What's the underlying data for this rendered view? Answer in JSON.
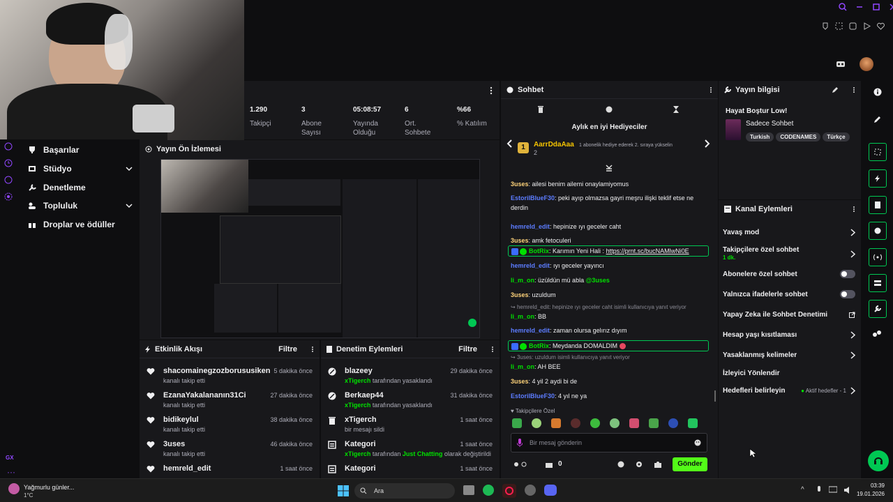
{
  "stats": [
    {
      "value": "1.290",
      "label": "Takipçi"
    },
    {
      "value": "3",
      "label": "Abone Sayısı"
    },
    {
      "value": "05:08:57",
      "label": "Yayında Olduğu"
    },
    {
      "value": "6",
      "label": "Ort. Sohbete"
    },
    {
      "value": "%66",
      "label": "% Katılım"
    }
  ],
  "nav": {
    "items": [
      {
        "label": "Başarılar"
      },
      {
        "label": "Stüdyo"
      },
      {
        "label": "Denetleme"
      },
      {
        "label": "Topluluk"
      },
      {
        "label": "Droplar ve ödüller"
      }
    ],
    "gx": "GX"
  },
  "preview": {
    "title": "Yayın Ön İzlemesi"
  },
  "activity": {
    "title": "Etkinlik Akışı",
    "filter": "Filtre",
    "rows": [
      {
        "name": "shacomainegzozborususiken",
        "sub": "kanalı takip etti",
        "time": "5 dakika önce"
      },
      {
        "name": "EzanaYakalananın31Ci",
        "sub": "kanalı takip etti",
        "time": "27 dakika önce"
      },
      {
        "name": "bidikeylul",
        "sub": "kanalı takip etti",
        "time": "38 dakika önce"
      },
      {
        "name": "3uses",
        "sub": "kanalı takip etti",
        "time": "46 dakika önce"
      },
      {
        "name": "hemreld_edit",
        "sub": "",
        "time": "1 saat önce"
      }
    ]
  },
  "modlog": {
    "title": "Denetim Eylemleri",
    "filter": "Filtre",
    "rows": [
      {
        "name": "blazeey",
        "by": "xTigerch",
        "rest": " tarafından yasaklandı",
        "extra": "",
        "tail": "",
        "time": "29 dakika önce"
      },
      {
        "name": "Berkaep44",
        "by": "xTigerch",
        "rest": " tarafından yasaklandı",
        "extra": "",
        "tail": "",
        "time": "31 dakika önce"
      },
      {
        "name": "xTigerch",
        "by": "",
        "rest": "bir mesajı sildi",
        "extra": "",
        "tail": "",
        "time": "1 saat önce"
      },
      {
        "name": "Kategori",
        "by": "xTigerch",
        "rest": " tarafından ",
        "extra": "Just Chatting",
        "tail": " olarak değiştirildi",
        "time": "1 saat önce"
      },
      {
        "name": "Kategori",
        "by": "",
        "rest": "",
        "extra": "",
        "tail": "",
        "time": "1 saat önce"
      }
    ]
  },
  "chat": {
    "title": "Sohbet",
    "gift_title": "Aylık en iyi Hediyeciler",
    "gifter": "AarrDdaAaa",
    "gifter_count": "2",
    "gift_hint": "1 abonelik hediye ederek 2. sıraya yükselin",
    "messages": [
      {
        "user": "3uses",
        "color": "#ffd37a",
        "text": "ailesi benim ailemi onaylamiyomus"
      },
      {
        "user": "EstorilBlueF30",
        "color": "#5c7cff",
        "text": "peki ayıp olmazsa gayri meşru ilişki teklif etse ne derdin"
      },
      {
        "user": "hemreld_edit",
        "color": "#5c7cff",
        "text": "hepinize ıyı geceler caht"
      },
      {
        "user": "3uses",
        "color": "#ffd37a",
        "text": "amk fetoculeri"
      },
      {
        "user": "BotRix",
        "color": "#00e100",
        "text": "Karımın Yeni Hali : ",
        "link": "https://prnt.sc/bucNAMlwNi0E"
      },
      {
        "user": "hemreld_edit",
        "color": "#5c7cff",
        "text": "ıyı geceler yayıncı"
      },
      {
        "user": "li_m_on",
        "color": "#00e100",
        "text": "üzüldün mü abla ",
        "mention": "@3uses"
      },
      {
        "user": "3uses",
        "color": "#ffd37a",
        "text": "uzuldum"
      },
      {
        "reply": "hemreld_edit: hepinize ıyı geceler caht isimli kullanıcıya yanıt veriyor"
      },
      {
        "user": "li_m_on",
        "color": "#00e100",
        "text": "BB"
      },
      {
        "user": "hemreld_edit",
        "color": "#5c7cff",
        "text": "zaman olursa gelırız dıyım"
      },
      {
        "user": "BotRix",
        "color": "#00e100",
        "text": "Meydanda DOMALDIM "
      },
      {
        "reply": "3uses: uzuldum isimli kullanıcıya yanıt veriyor"
      },
      {
        "user": "li_m_on",
        "color": "#00e100",
        "text": "AH BEE"
      },
      {
        "user": "3uses",
        "color": "#ffd37a",
        "text": "4 yil 2 aydi bi de"
      },
      {
        "user": "EstorilBlueF30",
        "color": "#5c7cff",
        "text": "4 yıl ne ya"
      }
    ],
    "followers_label": "Takipçilere Özel",
    "placeholder": "Bir mesaj gönderin",
    "points": "0",
    "send": "Gönder"
  },
  "info": {
    "title": "Yayın bilgisi",
    "stream_title": "Hayat Boştur Low!",
    "category": "Sadece Sohbet",
    "tags": [
      "Turkish",
      "CODENAMES",
      "Türkçe"
    ]
  },
  "channel": {
    "title": "Kanal Eylemleri",
    "rows": [
      {
        "label": "Yavaş mod",
        "sub": ""
      },
      {
        "label": "Takipçilere özel sohbet",
        "sub": "1 dk."
      },
      {
        "label": "Abonelere özel sohbet",
        "sub": ""
      },
      {
        "label": "Yalnızca ifadelerle sohbet",
        "sub": ""
      },
      {
        "label": "Yapay Zeka ile Sohbet Denetimi",
        "sub": ""
      },
      {
        "label": "Hesap yaşı kısıtlaması",
        "sub": ""
      },
      {
        "label": "Yasaklanmış kelimeler",
        "sub": ""
      },
      {
        "label": "İzleyici Yönlendir",
        "sub": ""
      },
      {
        "label": "Hedefleri belirleyin",
        "sub": ""
      }
    ],
    "goals_badge": "Aktif hedefler - 1"
  },
  "taskbar": {
    "weather_title": "Yağmurlu günler...",
    "weather_temp": "1°C",
    "search": "Ara",
    "time": "03:39",
    "date": "19.01.2026"
  }
}
